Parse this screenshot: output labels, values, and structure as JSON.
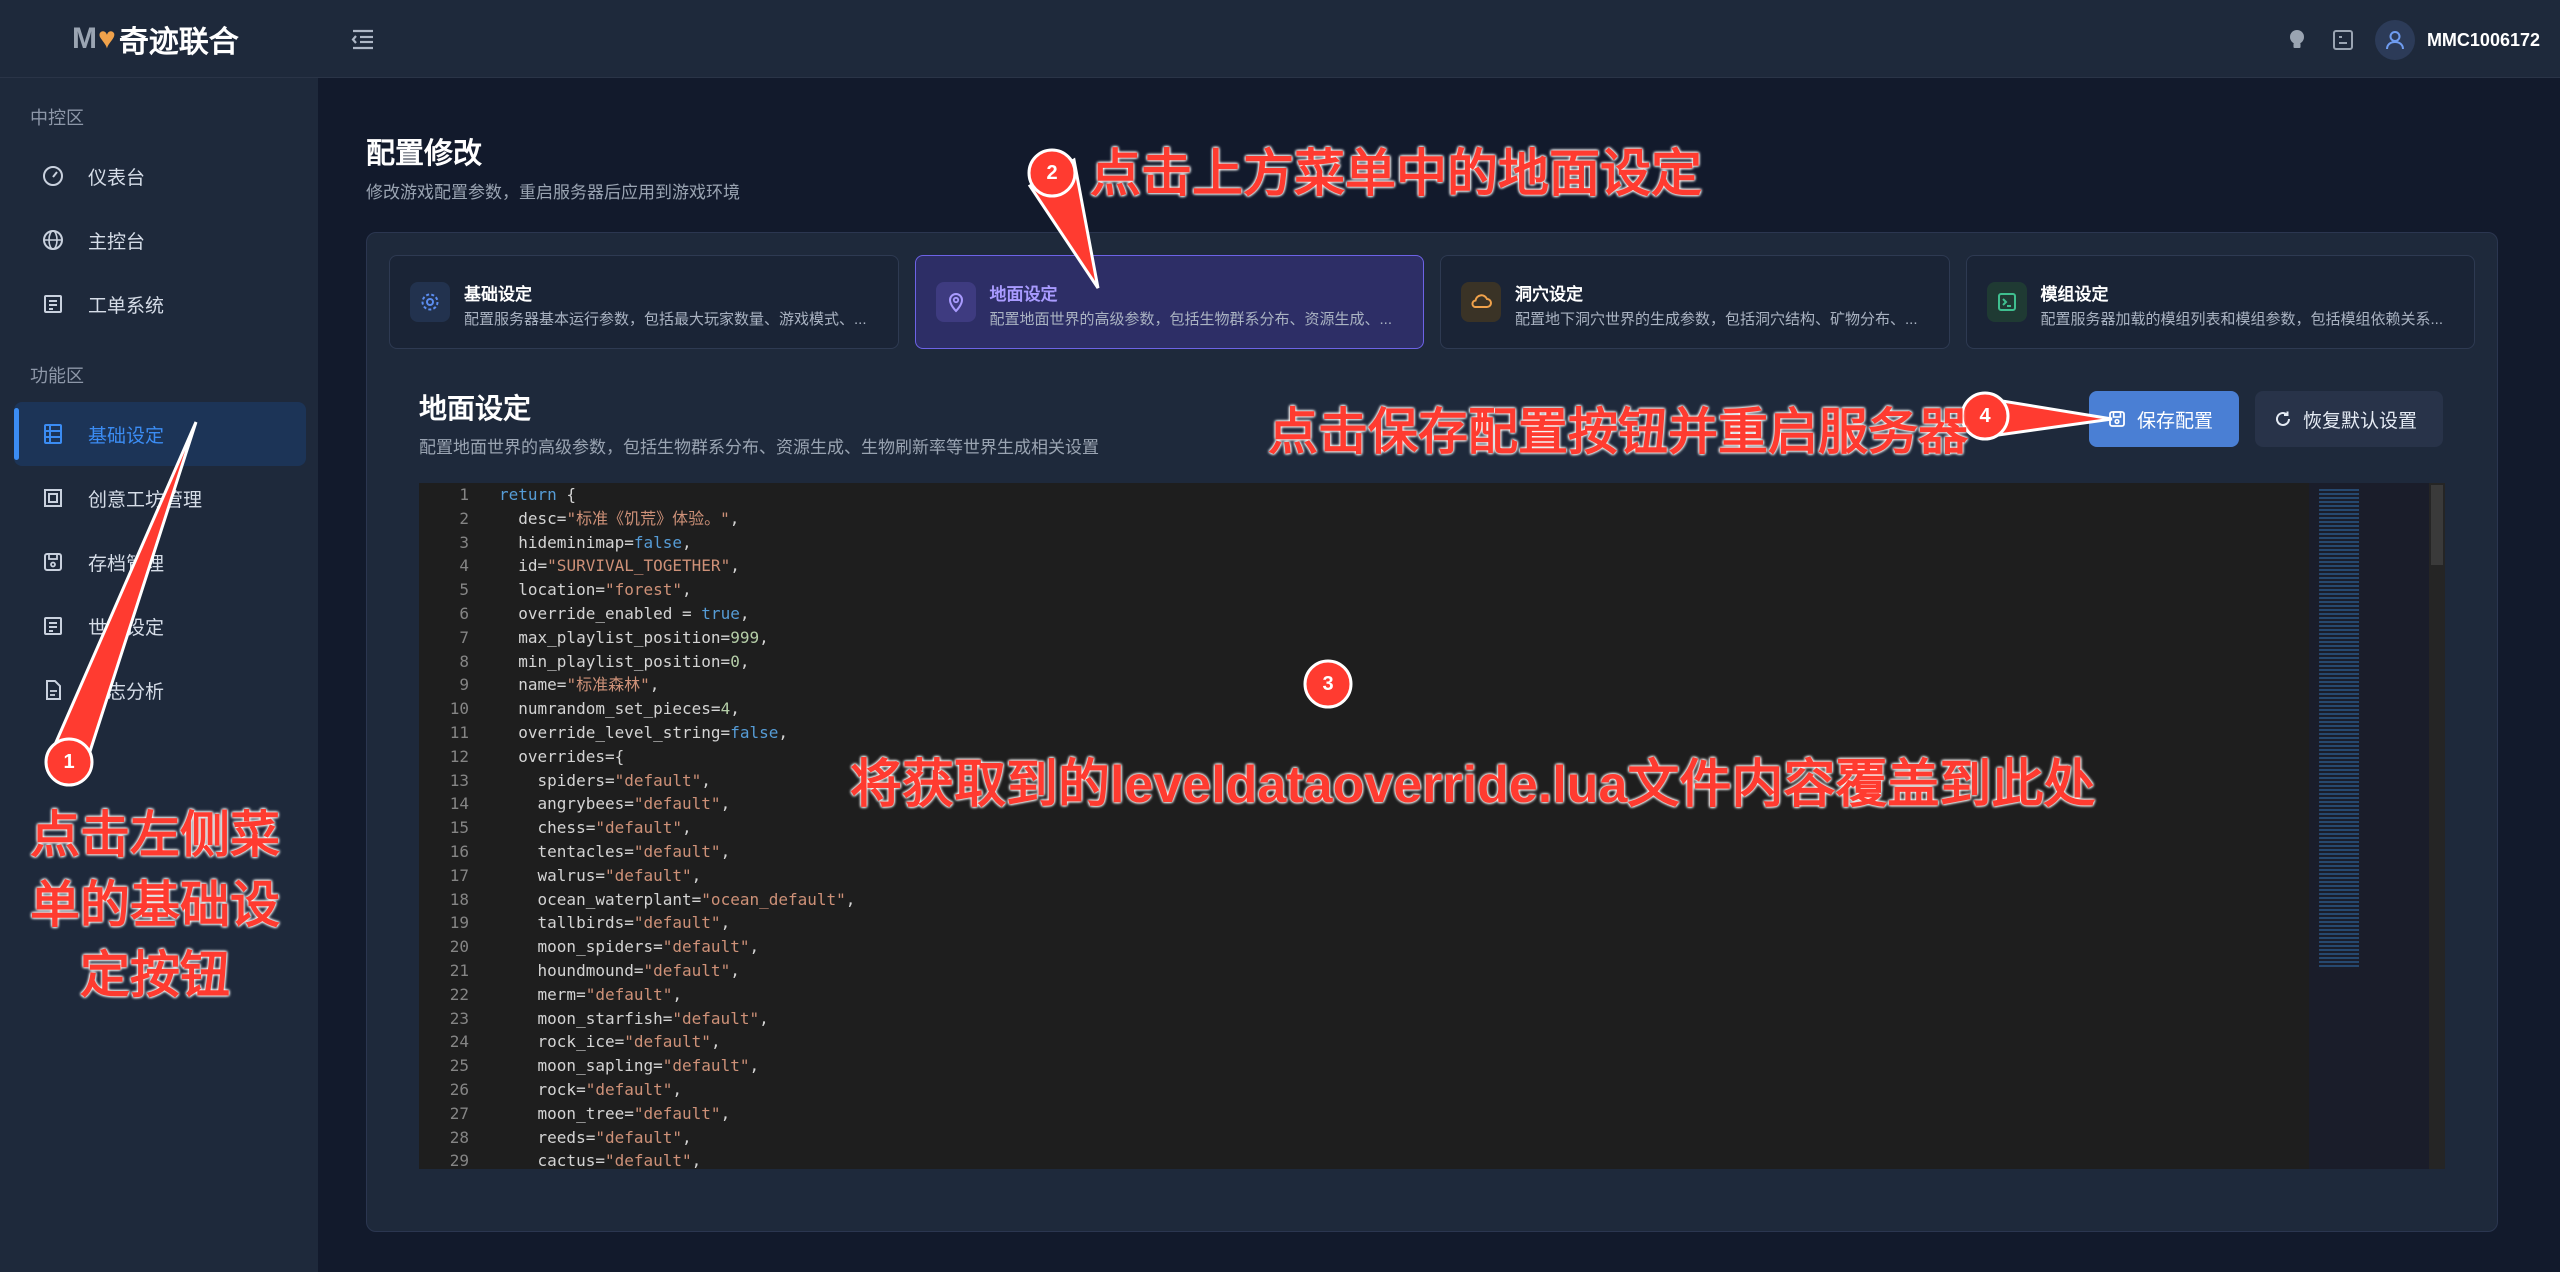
{
  "brand": {
    "logo_mark": "M",
    "logo_name": "奇迹联合"
  },
  "sidebar": {
    "sections": [
      {
        "label": "中控区",
        "items": [
          {
            "label": "仪表台",
            "icon": "gauge-icon"
          },
          {
            "label": "主控台",
            "icon": "globe-icon"
          },
          {
            "label": "工单系统",
            "icon": "list-icon"
          }
        ]
      },
      {
        "label": "功能区",
        "items": [
          {
            "label": "基础设定",
            "icon": "table-icon",
            "active": true
          },
          {
            "label": "创意工坊管理",
            "icon": "workshop-icon"
          },
          {
            "label": "存档管理",
            "icon": "save-icon"
          },
          {
            "label": "世界设定",
            "icon": "list-icon"
          },
          {
            "label": "日志分析",
            "icon": "document-icon"
          }
        ]
      }
    ]
  },
  "topbar": {
    "username": "MMC1006172"
  },
  "page": {
    "title": "配置修改",
    "subtitle": "修改游戏配置参数，重启服务器后应用到游戏环境"
  },
  "cards": [
    {
      "title": "基础设定",
      "desc": "配置服务器基本运行参数，包括最大玩家数量、游戏模式、...",
      "icon": "gear-icon"
    },
    {
      "title": "地面设定",
      "desc": "配置地面世界的高级参数，包括生物群系分布、资源生成、...",
      "icon": "location-icon",
      "active": true
    },
    {
      "title": "洞穴设定",
      "desc": "配置地下洞穴世界的生成参数，包括洞穴结构、矿物分布、...",
      "icon": "cloud-icon"
    },
    {
      "title": "模组设定",
      "desc": "配置服务器加载的模组列表和模组参数，包括模组依赖关系...",
      "icon": "terminal-icon"
    }
  ],
  "section": {
    "title": "地面设定",
    "desc": "配置地面世界的高级参数，包括生物群系分布、资源生成、生物刷新率等世界生成相关设置",
    "save_label": "保存配置",
    "reset_label": "恢复默认设置"
  },
  "editor": {
    "lines": [
      [
        [
          "kw",
          "return"
        ],
        [
          "p",
          " {"
        ]
      ],
      [
        [
          "p",
          "  desc="
        ],
        [
          "str",
          "\"标准《饥荒》体验。\""
        ],
        [
          "p",
          ","
        ]
      ],
      [
        [
          "p",
          "  hideminimap="
        ],
        [
          "kw",
          "false"
        ],
        [
          "p",
          ","
        ]
      ],
      [
        [
          "p",
          "  id="
        ],
        [
          "str",
          "\"SURVIVAL_TOGETHER\""
        ],
        [
          "p",
          ","
        ]
      ],
      [
        [
          "p",
          "  location="
        ],
        [
          "str",
          "\"forest\""
        ],
        [
          "p",
          ","
        ]
      ],
      [
        [
          "p",
          "  override_enabled = "
        ],
        [
          "kw",
          "true"
        ],
        [
          "p",
          ","
        ]
      ],
      [
        [
          "p",
          "  max_playlist_position="
        ],
        [
          "num",
          "999"
        ],
        [
          "p",
          ","
        ]
      ],
      [
        [
          "p",
          "  min_playlist_position="
        ],
        [
          "num",
          "0"
        ],
        [
          "p",
          ","
        ]
      ],
      [
        [
          "p",
          "  name="
        ],
        [
          "str",
          "\"标准森林\""
        ],
        [
          "p",
          ","
        ]
      ],
      [
        [
          "p",
          "  numrandom_set_pieces="
        ],
        [
          "num",
          "4"
        ],
        [
          "p",
          ","
        ]
      ],
      [
        [
          "p",
          "  override_level_string="
        ],
        [
          "kw",
          "false"
        ],
        [
          "p",
          ","
        ]
      ],
      [
        [
          "p",
          "  overrides={"
        ]
      ],
      [
        [
          "p",
          "    spiders="
        ],
        [
          "str",
          "\"default\""
        ],
        [
          "p",
          ","
        ]
      ],
      [
        [
          "p",
          "    angrybees="
        ],
        [
          "str",
          "\"default\""
        ],
        [
          "p",
          ","
        ]
      ],
      [
        [
          "p",
          "    chess="
        ],
        [
          "str",
          "\"default\""
        ],
        [
          "p",
          ","
        ]
      ],
      [
        [
          "p",
          "    tentacles="
        ],
        [
          "str",
          "\"default\""
        ],
        [
          "p",
          ","
        ]
      ],
      [
        [
          "p",
          "    walrus="
        ],
        [
          "str",
          "\"default\""
        ],
        [
          "p",
          ","
        ]
      ],
      [
        [
          "p",
          "    ocean_waterplant="
        ],
        [
          "str",
          "\"ocean_default\""
        ],
        [
          "p",
          ","
        ]
      ],
      [
        [
          "p",
          "    tallbirds="
        ],
        [
          "str",
          "\"default\""
        ],
        [
          "p",
          ","
        ]
      ],
      [
        [
          "p",
          "    moon_spiders="
        ],
        [
          "str",
          "\"default\""
        ],
        [
          "p",
          ","
        ]
      ],
      [
        [
          "p",
          "    houndmound="
        ],
        [
          "str",
          "\"default\""
        ],
        [
          "p",
          ","
        ]
      ],
      [
        [
          "p",
          "    merm="
        ],
        [
          "str",
          "\"default\""
        ],
        [
          "p",
          ","
        ]
      ],
      [
        [
          "p",
          "    moon_starfish="
        ],
        [
          "str",
          "\"default\""
        ],
        [
          "p",
          ","
        ]
      ],
      [
        [
          "p",
          "    rock_ice="
        ],
        [
          "str",
          "\"default\""
        ],
        [
          "p",
          ","
        ]
      ],
      [
        [
          "p",
          "    moon_sapling="
        ],
        [
          "str",
          "\"default\""
        ],
        [
          "p",
          ","
        ]
      ],
      [
        [
          "p",
          "    rock="
        ],
        [
          "str",
          "\"default\""
        ],
        [
          "p",
          ","
        ]
      ],
      [
        [
          "p",
          "    moon_tree="
        ],
        [
          "str",
          "\"default\""
        ],
        [
          "p",
          ","
        ]
      ],
      [
        [
          "p",
          "    reeds="
        ],
        [
          "str",
          "\"default\""
        ],
        [
          "p",
          ","
        ]
      ],
      [
        [
          "p",
          "    cactus="
        ],
        [
          "str",
          "\"default\""
        ],
        [
          "p",
          ","
        ]
      ]
    ]
  },
  "annotations": {
    "step1_badge": "1",
    "step1_text": "点击左侧菜单的基础设定按钮",
    "step2_badge": "2",
    "step2_text": "点击上方菜单中的地面设定",
    "step3_badge": "3",
    "step3_text": "将获取到的leveldataoverride.lua文件内容覆盖到此处",
    "step4_badge": "4",
    "step4_text": "点击保存配置按钮并重启服务器",
    "color": "#ff3b30"
  }
}
